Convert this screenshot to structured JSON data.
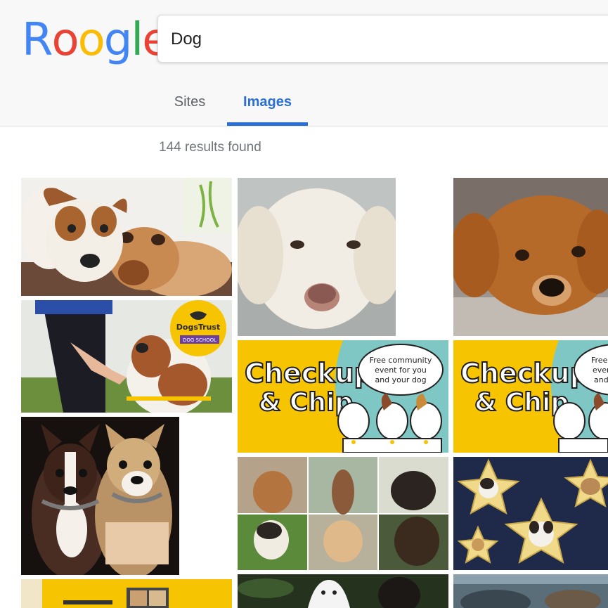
{
  "logo": {
    "letters": [
      "R",
      "o",
      "o",
      "g",
      "l",
      "e"
    ],
    "colors": [
      "#4285f4",
      "#ea4335",
      "#fbbc05",
      "#4285f4",
      "#34a853",
      "#ea4335"
    ]
  },
  "search": {
    "value": "Dog"
  },
  "tabs": [
    {
      "label": "Sites",
      "active": false
    },
    {
      "label": "Images",
      "active": true
    }
  ],
  "results": {
    "count_text": "144 results found"
  },
  "accent_color": "#2a6fd6",
  "images": {
    "dogs_trust": {
      "brand": "DogsTrust",
      "tag": "DOG SCHOOL"
    },
    "checkup_chip": {
      "title_line1": "Checkup",
      "title_line2": "& Chip",
      "cloud_line1": "Free community",
      "cloud_line2": "event for you",
      "cloud_line3": "and your dog"
    },
    "checkup_chip_2": {
      "title_line1": "Checkup",
      "title_line2": "& Chip",
      "cloud_line1": "Free c",
      "cloud_line2": "even",
      "cloud_line3": "and"
    }
  }
}
